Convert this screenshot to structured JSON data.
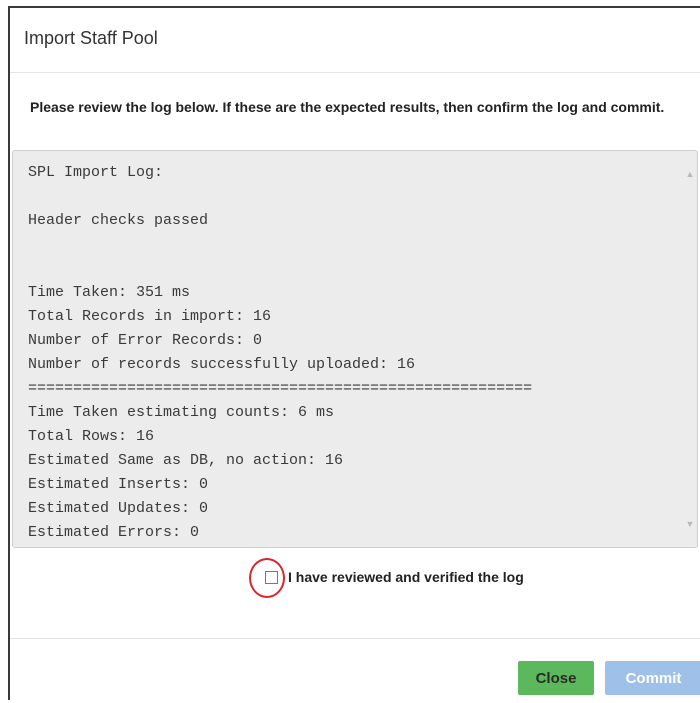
{
  "dialog": {
    "title": "Import Staff Pool",
    "instructions": "Please review the log below. If these are the expected results, then confirm the log and commit."
  },
  "log": {
    "lines": [
      "SPL Import Log:",
      "",
      "Header checks passed",
      "",
      "",
      "Time Taken: 351 ms",
      "Total Records in import: 16",
      "Number of Error Records: 0",
      "Number of records successfully uploaded: 16",
      "========================================================",
      "Time Taken estimating counts: 6 ms",
      "Total Rows: 16",
      "Estimated Same as DB, no action: 16",
      "Estimated Inserts: 0",
      "Estimated Updates: 0",
      "Estimated Errors: 0"
    ]
  },
  "verify": {
    "label": "I have reviewed and verified the log",
    "checked": false
  },
  "footer": {
    "close_label": "Close",
    "commit_label": "Commit"
  },
  "colors": {
    "close_button": "#5cb85c",
    "commit_button_disabled": "#9fc1e8",
    "highlight_circle": "#d9262a",
    "log_background": "#ececec"
  }
}
